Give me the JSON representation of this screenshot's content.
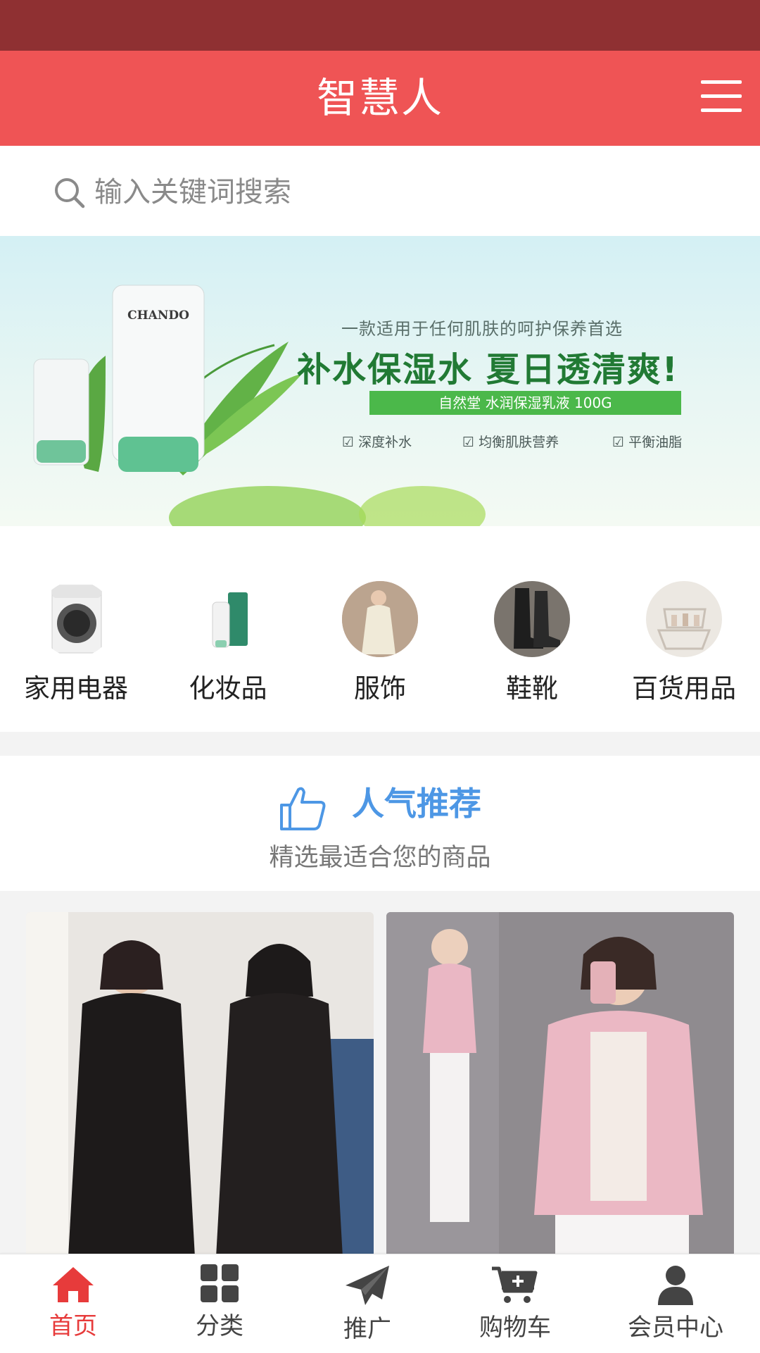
{
  "header": {
    "title": "智慧人",
    "menu_icon": "hamburger-menu-icon"
  },
  "search": {
    "placeholder": "输入关键词搜索",
    "icon": "search-icon"
  },
  "banner": {
    "brand": "CHANDO",
    "tagline": "一款适用于任何肌肤的呵护保养首选",
    "headline": "补水保湿水 夏日透清爽!",
    "product_name": "自然堂 水润保湿乳液 100G",
    "features": [
      "深度补水",
      "均衡肌肤营养",
      "平衡油脂"
    ],
    "slide_count": 3,
    "active_slide": 2,
    "colors": {
      "dot_active": "#1e7ff0",
      "dot_inactive": "#b9c6c6"
    }
  },
  "categories": [
    {
      "label": "家用电器",
      "icon": "washing-machine-image"
    },
    {
      "label": "化妆品",
      "icon": "cosmetics-image"
    },
    {
      "label": "服饰",
      "icon": "clothing-image"
    },
    {
      "label": "鞋靴",
      "icon": "boots-image"
    },
    {
      "label": "百货用品",
      "icon": "household-goods-image"
    }
  ],
  "hot": {
    "title": "人气推荐",
    "subtitle": "精选最适合您的商品",
    "icon": "thumbs-up-icon"
  },
  "products": [
    {
      "image": "black-hooded-down-coat-photo"
    },
    {
      "image": "pink-short-down-jacket-photo"
    }
  ],
  "tabbar": [
    {
      "label": "首页",
      "icon": "home-icon",
      "active": true
    },
    {
      "label": "分类",
      "icon": "grid-icon",
      "active": false
    },
    {
      "label": "推广",
      "icon": "paper-plane-icon",
      "active": false
    },
    {
      "label": "购物车",
      "icon": "cart-icon",
      "active": false
    },
    {
      "label": "会员中心",
      "icon": "user-icon",
      "active": false
    }
  ],
  "colors": {
    "header": "#ef5455",
    "statusbar": "#8f3032",
    "accent_blue": "#4d97e5",
    "active_tab": "#e73b3b",
    "inactive_tab": "#444444"
  }
}
